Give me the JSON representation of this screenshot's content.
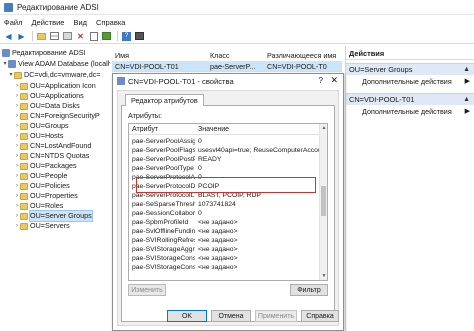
{
  "window": {
    "title": "Редактирование ADSI"
  },
  "menu": [
    "Файл",
    "Действие",
    "Вид",
    "Справка"
  ],
  "toolbar": [
    "back-arrow-icon",
    "forward-arrow-icon",
    "folder-icon",
    "grid-icon",
    "refresh-icon",
    "delete-icon",
    "export-icon",
    "properties-icon",
    "help-icon",
    "console-icon"
  ],
  "tree": [
    {
      "label": "Редактирование ADSI",
      "icon": "adsi-icon"
    },
    {
      "label": "View ADAM Database (localh",
      "icon": "database-icon"
    },
    {
      "label": "DC=vdi,dc=vmware,dc=",
      "icon": "folder-icon"
    },
    {
      "label": "OU=Application Icon",
      "icon": "folder-icon"
    },
    {
      "label": "OU=Applications",
      "icon": "folder-icon"
    },
    {
      "label": "OU=Data Disks",
      "icon": "folder-icon"
    },
    {
      "label": "CN=ForeignSecurityP",
      "icon": "folder-icon"
    },
    {
      "label": "OU=Groups",
      "icon": "folder-icon"
    },
    {
      "label": "OU=Hosts",
      "icon": "folder-icon"
    },
    {
      "label": "CN=LostAndFound",
      "icon": "folder-icon"
    },
    {
      "label": "CN=NTDS Quotas",
      "icon": "folder-icon"
    },
    {
      "label": "OU=Packages",
      "icon": "folder-icon"
    },
    {
      "label": "OU=People",
      "icon": "folder-icon"
    },
    {
      "label": "OU=Policies",
      "icon": "folder-icon"
    },
    {
      "label": "OU=Properties",
      "icon": "folder-icon"
    },
    {
      "label": "OU=Roles",
      "icon": "folder-icon"
    },
    {
      "label": "OU=Server Groups",
      "icon": "folder-icon"
    },
    {
      "label": "OU=Servers",
      "icon": "folder-icon"
    }
  ],
  "list": {
    "headers": [
      "Имя",
      "Класс",
      "Различающееся имя"
    ],
    "rows": [
      {
        "name": "CN=VDI-POOL-T01",
        "class": "pae-ServerP...",
        "dn": "CN=VDI-POOL-T0"
      }
    ]
  },
  "actions": {
    "title": "Действия",
    "groups": [
      {
        "header": "OU=Server Groups",
        "link": "Дополнительные действия"
      },
      {
        "header": "CN=VDI-POOL-T01",
        "link": "Дополнительные действия"
      }
    ]
  },
  "dialog": {
    "title": "CN=VDI-POOL-T01 - свойства",
    "help": "?",
    "close": "✕",
    "tab": "Редактор атрибутов",
    "attributes_label": "Атрибуты:",
    "columns": [
      "Атрибут",
      "Значение"
    ],
    "rows": [
      [
        "pae-ServerPoolAssig...",
        "0"
      ],
      [
        "pae-ServerPoolFlags",
        "usesvl40api=true; ReuseComputerAccount=..."
      ],
      [
        "pae-ServerPoolPostP...",
        "READY"
      ],
      [
        "pae-ServerPoolType",
        "0"
      ],
      [
        "pae-ServerProtocolAl...",
        "0"
      ],
      [
        "pae-ServerProtocolD...",
        "PCOIP"
      ],
      [
        "pae-ServerProtocolL...",
        "BLAST, PCOIP, RDP"
      ],
      [
        "pae-SeSparseThresh...",
        "1073741824"
      ],
      [
        "pae-SessionCollabora...",
        "0"
      ],
      [
        "pae-SpbmProfileId",
        "<не задано>"
      ],
      [
        "pae-SvlOfflineFunding",
        "<не задано>"
      ],
      [
        "pae-SVIRollingRefreshl...",
        "<не задано>"
      ],
      [
        "pae-SVIStorageAggre...",
        "<не задано>"
      ],
      [
        "pae-SVIStorageCons...",
        "<не задано>"
      ],
      [
        "pae-SVIStorageConsA...",
        "<не задано>"
      ]
    ],
    "buttons": {
      "edit": "Изменить",
      "filter": "Фильтр",
      "ok": "OK",
      "cancel": "Отмена",
      "apply": "Применить",
      "help": "Справка"
    }
  },
  "colors": {
    "selection": "#cce4f7",
    "highlight_box": "#d0312d",
    "actions_header": "#dfe8f4"
  }
}
